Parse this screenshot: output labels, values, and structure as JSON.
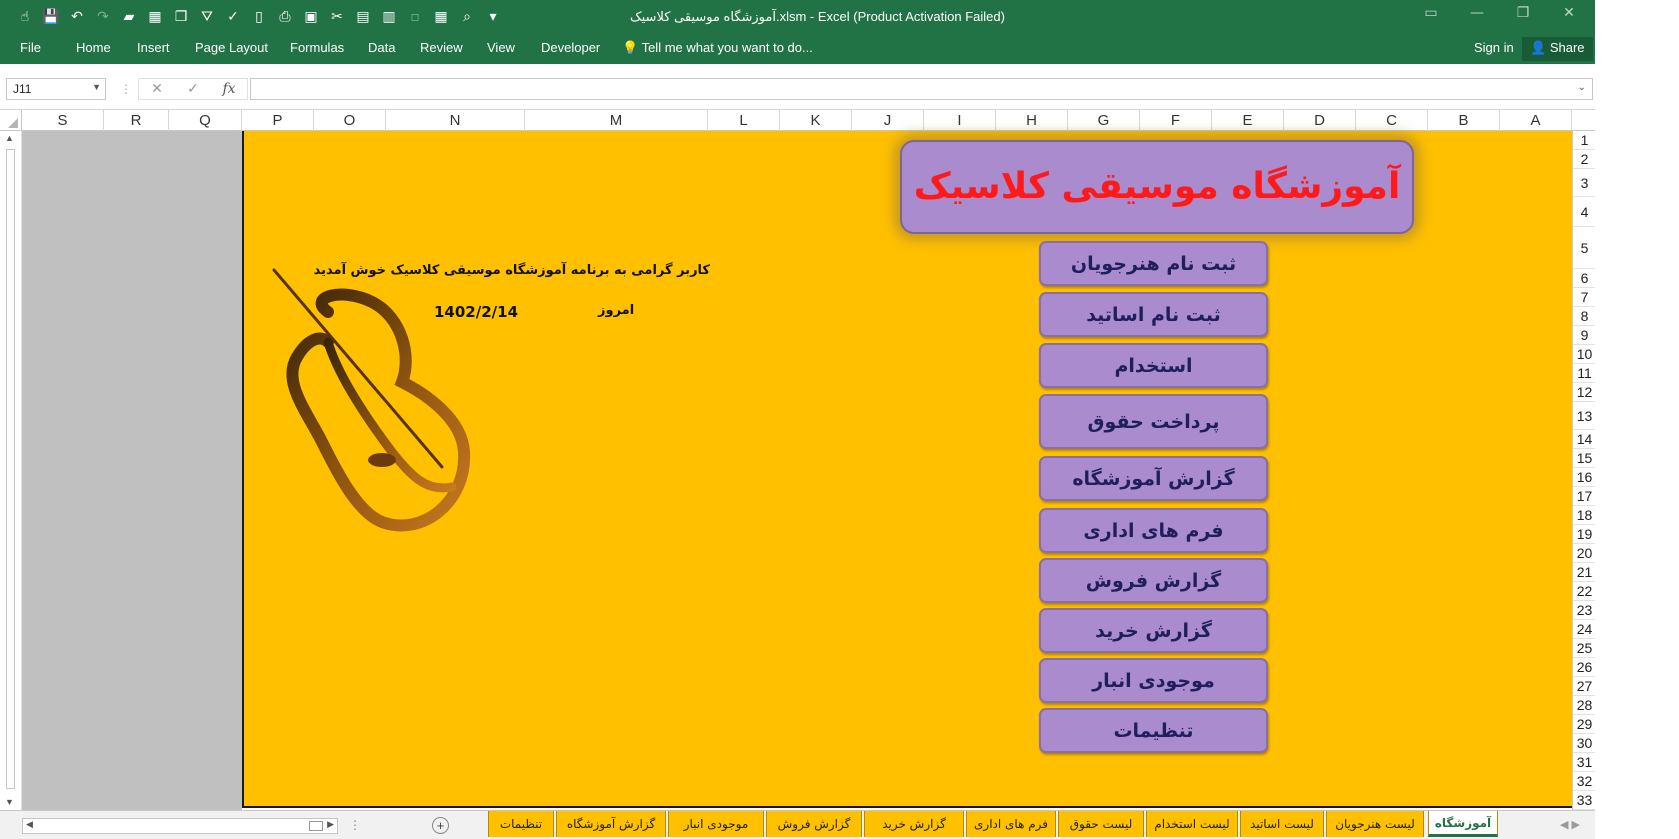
{
  "window": {
    "title": "آموزشگاه موسیقی کلاسیک.xlsm - Excel (Product Activation Failed)"
  },
  "ribbon": {
    "tabs": [
      "File",
      "Home",
      "Insert",
      "Page Layout",
      "Formulas",
      "Data",
      "Review",
      "View",
      "Developer"
    ],
    "tell_me": "Tell me what you want to do...",
    "sign_in": "Sign in",
    "share": "Share"
  },
  "formula_bar": {
    "name_box": "J11",
    "fx": "fx",
    "content": ""
  },
  "columns": [
    "S",
    "R",
    "Q",
    "P",
    "O",
    "N",
    "M",
    "L",
    "K",
    "J",
    "I",
    "H",
    "G",
    "F",
    "E",
    "D",
    "C",
    "B",
    "A"
  ],
  "rows": [
    "1",
    "2",
    "3",
    "4",
    "5",
    "6",
    "7",
    "8",
    "9",
    "10",
    "11",
    "12",
    "13",
    "14",
    "15",
    "16",
    "17",
    "18",
    "19",
    "20",
    "21",
    "22",
    "23",
    "24",
    "25",
    "26",
    "27",
    "28",
    "29",
    "30",
    "31",
    "32",
    "33"
  ],
  "sheet": {
    "title": "آموزشگاه موسیقی کلاسیک",
    "welcome": "کاربر گرامی به برنامه آموزشگاه موسیقی کلاسیک خوش آمدید",
    "today_label": "امروز",
    "today_date": "1402/2/14",
    "menu": [
      "ثبت نام هنرجویان",
      "ثبت نام اساتید",
      "استخدام",
      "پرداخت حقوق",
      "گزارش آموزشگاه",
      "فرم های اداری",
      "گزارش فروش",
      "گزارش خرید",
      "موجودی انبار",
      "تنظیمات"
    ]
  },
  "sheet_tabs": [
    "آموزشگاه",
    "لیست هنرجویان",
    "لیست اساتید",
    "لیست استخدام",
    "لیست حقوق",
    "فرم های اداری",
    "گزارش خرید",
    "گزارش فروش",
    "موجودی انبار",
    "گزارش آموزشگاه",
    "تنظیمات"
  ],
  "active_sheet_tab": "آموزشگاه",
  "colors": {
    "excel_green": "#217346",
    "sheet_gold": "#ffc000",
    "button_purple": "#a98bce",
    "title_red": "#ff1a1a",
    "button_text": "#1f1f5c"
  }
}
